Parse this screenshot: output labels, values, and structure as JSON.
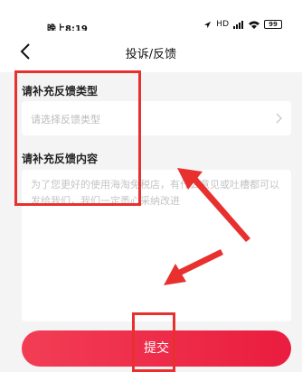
{
  "status_bar": {
    "time": "晚上8:19",
    "network_label": "HD",
    "battery": "99"
  },
  "nav": {
    "title": "投诉/反馈",
    "back_icon": "chevron-left-icon"
  },
  "feedback_type": {
    "label": "请补充反馈类型",
    "placeholder": "请选择反馈类型"
  },
  "feedback_content": {
    "label": "请补充反馈内容",
    "placeholder": "为了您更好的使用海淘免税店，有什么意见或吐槽都可以发给我们，我们一定悉心采纳改进"
  },
  "submit": {
    "label": "提交"
  },
  "colors": {
    "accent": "#ea1d3f",
    "annotation": "#e8302f",
    "background": "#f4f4f4"
  }
}
